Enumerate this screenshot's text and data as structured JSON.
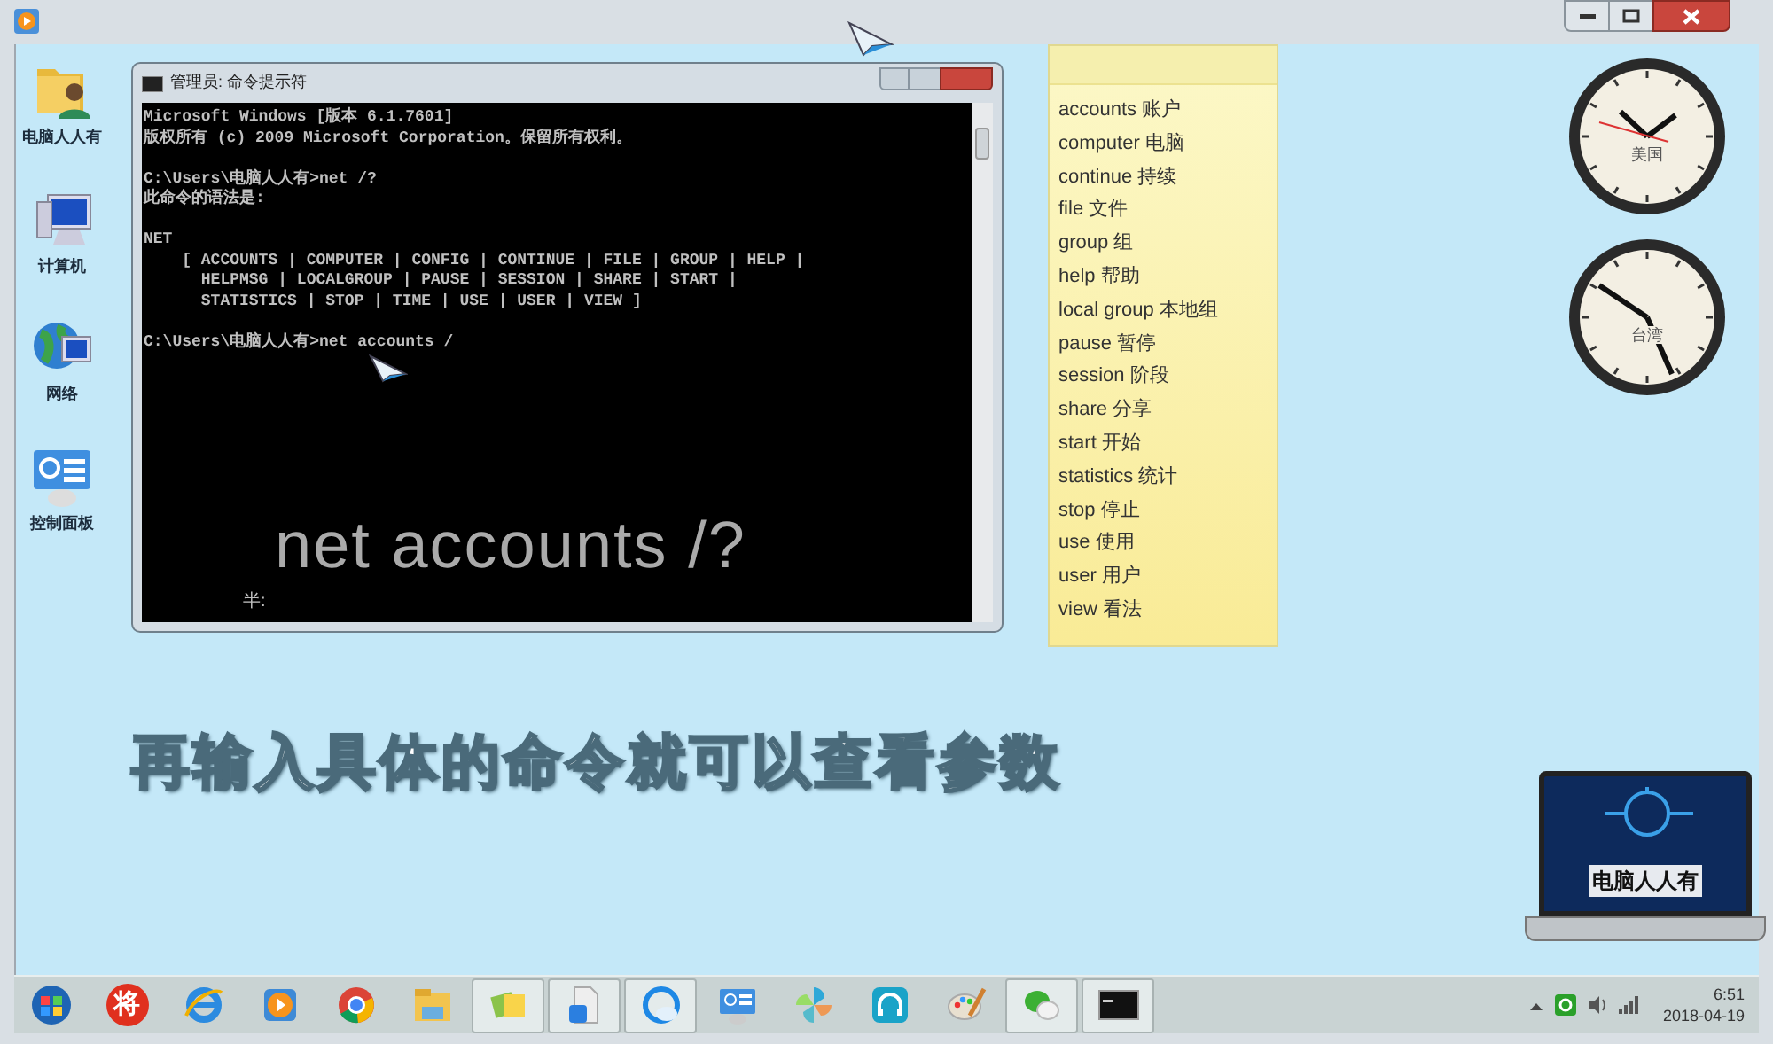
{
  "desktop_icons": [
    {
      "label": "电脑人人有",
      "kind": "user-folder"
    },
    {
      "label": "计算机",
      "kind": "computer"
    },
    {
      "label": "网络",
      "kind": "network"
    },
    {
      "label": "控制面板",
      "kind": "control-panel"
    }
  ],
  "console": {
    "title": "管理员: 命令提示符",
    "blocks": [
      [
        "Microsoft Windows [版本 6.1.7601]",
        "版权所有 (c) 2009 Microsoft Corporation。保留所有权利。"
      ],
      [
        "C:\\Users\\电脑人人有>net /?",
        "此命令的语法是:"
      ],
      [
        "NET",
        "    [ ACCOUNTS | COMPUTER | CONFIG | CONTINUE | FILE | GROUP | HELP |",
        "      HELPMSG | LOCALGROUP | PAUSE | SESSION | SHARE | START |",
        "      STATISTICS | STOP | TIME | USE | USER | VIEW ]"
      ],
      [
        "C:\\Users\\电脑人人有>net accounts /"
      ]
    ],
    "overlay": "net accounts /?",
    "partial": "半:"
  },
  "sticky_note": [
    "accounts 账户",
    "computer 电脑",
    "continue 持续",
    "file 文件",
    "group 组",
    "help 帮助",
    "local group 本地组",
    "pause 暂停",
    "session 阶段",
    "share 分享",
    "start 开始",
    "statistics 统计",
    "stop 停止",
    "use 使用",
    "user 用户",
    "view 看法"
  ],
  "clocks": [
    {
      "label": "美国"
    },
    {
      "label": "台湾"
    }
  ],
  "caption": "再输入具体的命令就可以查看参数",
  "logo": {
    "text": "电脑人人有"
  },
  "taskbar": [
    {
      "kind": "start",
      "active": false
    },
    {
      "kind": "badge",
      "text": "将",
      "active": false
    },
    {
      "kind": "ie",
      "active": false
    },
    {
      "kind": "player",
      "active": false
    },
    {
      "kind": "chrome",
      "active": false
    },
    {
      "kind": "explorer",
      "active": false
    },
    {
      "kind": "notes",
      "active": true
    },
    {
      "kind": "file",
      "active": true
    },
    {
      "kind": "cloud",
      "active": true
    },
    {
      "kind": "panel",
      "active": false
    },
    {
      "kind": "pinwheel",
      "active": false
    },
    {
      "kind": "headset",
      "active": false
    },
    {
      "kind": "paint",
      "active": false
    },
    {
      "kind": "wechat",
      "active": true
    },
    {
      "kind": "cmd",
      "active": true
    }
  ],
  "clock": {
    "time": "6:51",
    "date": "2018-04-19"
  }
}
